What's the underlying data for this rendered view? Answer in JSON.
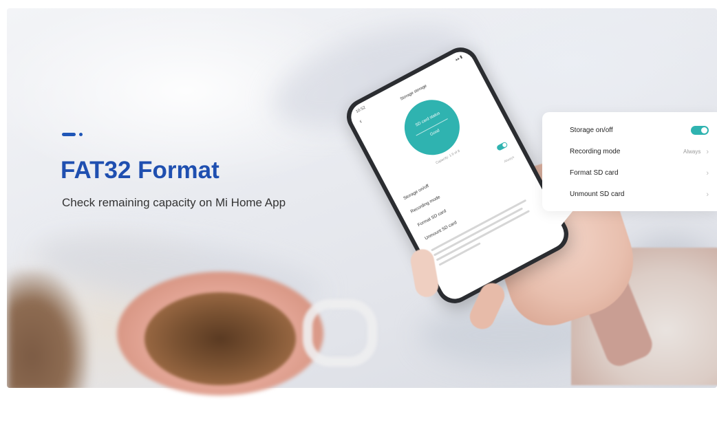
{
  "headline": "FAT32 Format",
  "subline": "Check remaining capacity on Mi Home App",
  "accent_color": "#1f4fb0",
  "teal_color": "#2fb3b0",
  "settings_card": {
    "items": [
      {
        "label": "Storage on/off",
        "toggle_on": true
      },
      {
        "label": "Recording mode",
        "value": "Always"
      },
      {
        "label": "Format SD card"
      },
      {
        "label": "Unmount SD card"
      }
    ]
  },
  "phone": {
    "status_time": "10:52",
    "title": "Storage storage",
    "circle_line1": "SD card status",
    "circle_line2": "Good",
    "capacity_text": "Capacity: 1.9 of 8",
    "rows": [
      {
        "label": "Storage on/off",
        "toggle_on": true
      },
      {
        "label": "Recording mode",
        "value": "Always"
      },
      {
        "label": "Format SD card"
      },
      {
        "label": "Unmount SD card"
      }
    ]
  }
}
